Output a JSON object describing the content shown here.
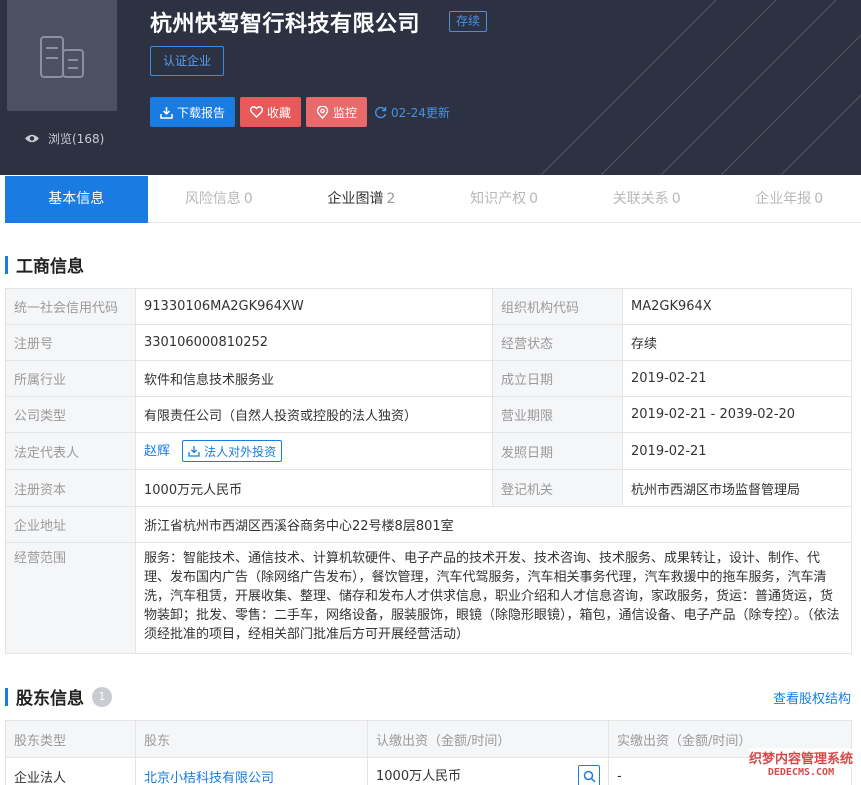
{
  "header": {
    "company_name": "杭州快驾智行科技有限公司",
    "status_tag": "存续",
    "cert_label": "认证企业",
    "views_label": "浏览(168)",
    "download_label": "下载报告",
    "favorite_label": "收藏",
    "monitor_label": "监控",
    "update_label": "02-24更新"
  },
  "tabs": [
    {
      "label": "基本信息",
      "count": ""
    },
    {
      "label": "风险信息",
      "count": "0"
    },
    {
      "label": "企业图谱",
      "count": "2"
    },
    {
      "label": "知识产权",
      "count": "0"
    },
    {
      "label": "关联关系",
      "count": "0"
    },
    {
      "label": "企业年报",
      "count": "0"
    }
  ],
  "business": {
    "title": "工商信息",
    "credit_code_label": "统一社会信用代码",
    "credit_code": "91330106MA2GK964XW",
    "org_code_label": "组织机构代码",
    "org_code": "MA2GK964X",
    "reg_no_label": "注册号",
    "reg_no": "330106000810252",
    "status_label": "经营状态",
    "status": "存续",
    "industry_label": "所属行业",
    "industry": "软件和信息技术服务业",
    "founded_label": "成立日期",
    "founded": "2019-02-21",
    "type_label": "公司类型",
    "type": "有限责任公司（自然人投资或控股的法人独资）",
    "term_label": "营业期限",
    "term": "2019-02-21 - 2039-02-20",
    "legal_rep_label": "法定代表人",
    "legal_rep": "赵辉",
    "legal_invest_label": "法人对外投资",
    "license_date_label": "发照日期",
    "license_date": "2019-02-21",
    "capital_label": "注册资本",
    "capital": "1000万元人民币",
    "authority_label": "登记机关",
    "authority": "杭州市西湖区市场监督管理局",
    "address_label": "企业地址",
    "address": "浙江省杭州市西湖区西溪谷商务中心22号楼8层801室",
    "scope_label": "经营范围",
    "scope": "服务：智能技术、通信技术、计算机软硬件、电子产品的技术开发、技术咨询、技术服务、成果转让，设计、制作、代理、发布国内广告（除网络广告发布），餐饮管理，汽车代驾服务，汽车相关事务代理，汽车救援中的拖车服务，汽车清洗，汽车租赁，开展收集、整理、储存和发布人才供求信息，职业介绍和人才信息咨询，家政服务，货运：普通货运，货物装卸；批发、零售：二手车，网络设备，服装服饰，眼镜（除隐形眼镜），箱包，通信设备、电子产品（除专控）。（依法须经批准的项目，经相关部门批准后方可开展经营活动）"
  },
  "shareholders": {
    "title": "股东信息",
    "count": "1",
    "view_structure": "查看股权结构",
    "headers": [
      "股东类型",
      "股东",
      "认缴出资（金额/时间）",
      "实缴出资（金额/时间）"
    ],
    "rows": [
      {
        "type": "企业法人",
        "name": "北京小桔科技有限公司",
        "subscribed": "1000万人民币",
        "paid": "-"
      }
    ]
  },
  "watermark": {
    "line1": "织梦内容管理系统",
    "line2": "DEDECMS.COM"
  },
  "colors": {
    "header_bg": "#2d3242",
    "accent_blue": "#1a7ce2",
    "favorite_red": "#e85a5a"
  }
}
